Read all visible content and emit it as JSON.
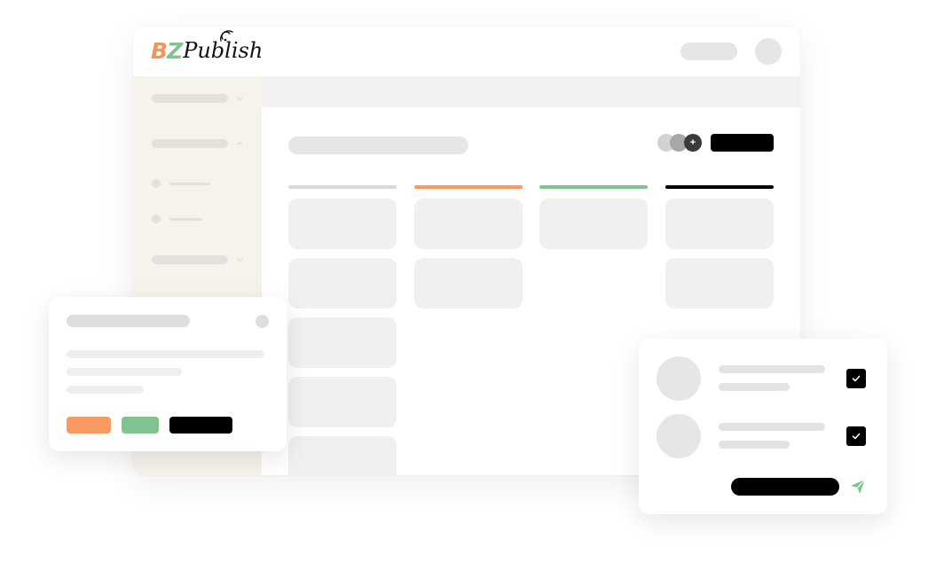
{
  "brand": {
    "logo_part1": "B",
    "logo_part2": "Z",
    "logo_part3": "Publish",
    "accent_orange": "#f89a62",
    "accent_green": "#7fc391",
    "accent_black": "#000000"
  },
  "board": {
    "add_member_glyph": "+",
    "columns": [
      {
        "color": "#d9d9d9",
        "cards": 5
      },
      {
        "color": "#f89a62",
        "cards": 2
      },
      {
        "color": "#7fc391",
        "cards": 1
      },
      {
        "color": "#000000",
        "cards": 2
      }
    ]
  },
  "icons": {
    "send": "send-icon",
    "check": "check-icon",
    "chevron": "chevron-icon"
  }
}
